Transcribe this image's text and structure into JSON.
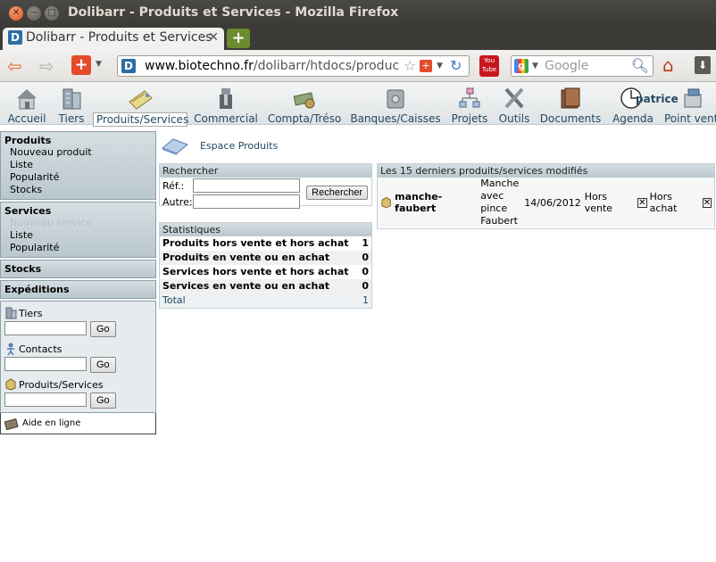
{
  "window": {
    "title": "Dolibarr - Produits et Services - Mozilla Firefox"
  },
  "browser": {
    "tab_title": "Dolibarr - Produits et Services",
    "url_host": "www.biotechno.fr",
    "url_path": "/dolibarr/htdocs/produc",
    "search_placeholder": "Google"
  },
  "topmenu": [
    {
      "label": "Accueil",
      "icon": "home-icon"
    },
    {
      "label": "Tiers",
      "icon": "building-icon"
    },
    {
      "label": "Produits/Services",
      "icon": "products-icon"
    },
    {
      "label": "Commercial",
      "icon": "commercial-icon"
    },
    {
      "label": "Compta/Tréso",
      "icon": "money-icon"
    },
    {
      "label": "Banques/Caisses",
      "icon": "bank-icon"
    },
    {
      "label": "Projets",
      "icon": "project-icon"
    },
    {
      "label": "Outils",
      "icon": "tools-icon"
    },
    {
      "label": "Documents",
      "icon": "documents-icon"
    },
    {
      "label": "Agenda",
      "icon": "clock-icon"
    },
    {
      "label": "Point vente",
      "icon": "pos-icon"
    }
  ],
  "user": {
    "name": "patrice"
  },
  "sidebar": {
    "produits": {
      "title": "Produits",
      "items": [
        "Nouveau produit",
        "Liste",
        "Popularité",
        "Stocks"
      ]
    },
    "services": {
      "title": "Services",
      "items": [
        "Nouveau service",
        "Liste",
        "Popularité"
      ]
    },
    "stocks": {
      "title": "Stocks"
    },
    "expeditions": {
      "title": "Expéditions"
    },
    "quicksearch": {
      "tiers_label": "Tiers",
      "contacts_label": "Contacts",
      "produits_label": "Produits/Services",
      "go_label": "Go"
    },
    "help_label": "Aide en ligne"
  },
  "breadcrumb": {
    "label": "Espace Produits"
  },
  "search_panel": {
    "title": "Rechercher",
    "ref_label": "Réf.:",
    "autre_label": "Autre:",
    "button_label": "Rechercher"
  },
  "stats_panel": {
    "title": "Statistiques",
    "rows": [
      {
        "label": "Produits hors vente et hors achat",
        "value": "1"
      },
      {
        "label": "Produits en vente ou en achat",
        "value": "0"
      },
      {
        "label": "Services hors vente et hors achat",
        "value": "0"
      },
      {
        "label": "Services en vente ou en achat",
        "value": "0"
      }
    ],
    "total_label": "Total",
    "total_value": "1"
  },
  "recent_panel": {
    "title": "Les 15 derniers produits/services modifiés",
    "rows": [
      {
        "ref": "manche-faubert",
        "label_lines": [
          "Manche",
          "avec",
          "pince",
          "Faubert"
        ],
        "date": "14/06/2012",
        "sale_status": "Hors vente",
        "buy_status": "Hors achat"
      }
    ]
  },
  "colors": {
    "menu_text": "#234a62",
    "panel_head": "#c4cfd5",
    "titlebar": "#3c3b37",
    "firefox_accent": "#e66d2a"
  }
}
